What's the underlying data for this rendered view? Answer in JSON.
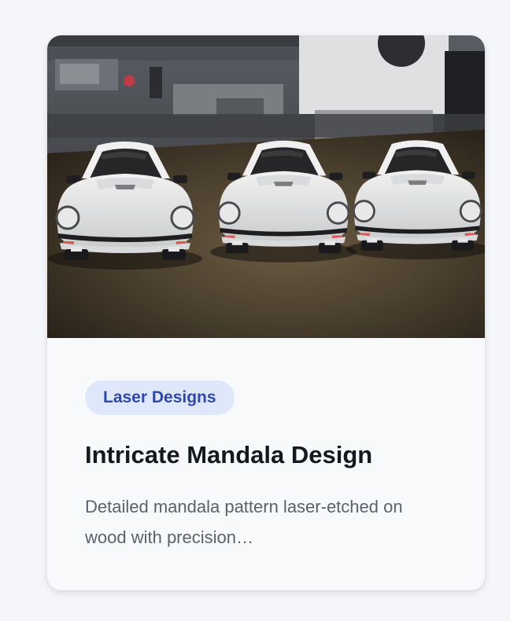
{
  "card": {
    "image_alt": "Three white 3D-printed model cars on a dark surface",
    "category": "Laser Designs",
    "title": "Intricate Mandala Design",
    "description": "Detailed mandala pattern laser-etched on wood with precision…"
  },
  "colors": {
    "page_background": "#f4f6f9",
    "card_background": "#f8f9fb",
    "badge_background": "#dfe8fb",
    "badge_text": "#2f48b0",
    "title_text": "#141821",
    "description_text": "#5a616c"
  }
}
